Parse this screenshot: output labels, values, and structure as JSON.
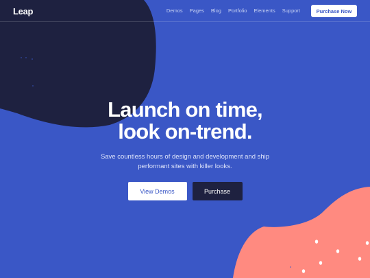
{
  "brand": {
    "logo": "Leap"
  },
  "nav": {
    "items": [
      "Demos",
      "Pages",
      "Blog",
      "Portfolio",
      "Elements",
      "Support"
    ],
    "cta": "Purchase Now"
  },
  "hero": {
    "title_line1": "Launch on time,",
    "title_line2": "look on-trend.",
    "subtitle": "Save countless hours of design and development and ship performant sites with killer looks.",
    "primary_button": "View Demos",
    "secondary_button": "Purchase"
  },
  "colors": {
    "background": "#3a57c6",
    "dark_blob": "#1e2140",
    "coral_blob": "#ff8a80",
    "white": "#ffffff"
  }
}
